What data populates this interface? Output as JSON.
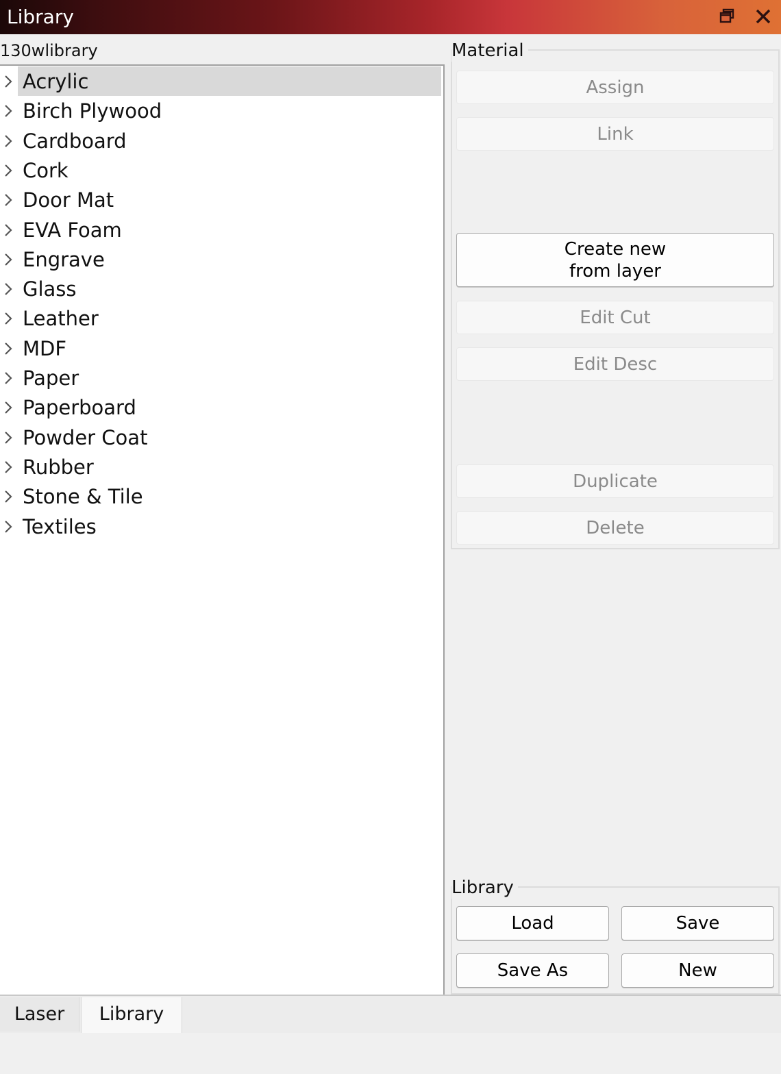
{
  "window": {
    "title": "Library"
  },
  "library_name": "130wlibrary",
  "tree": {
    "selected_index": 0,
    "items": [
      {
        "label": "Acrylic"
      },
      {
        "label": "Birch Plywood"
      },
      {
        "label": "Cardboard"
      },
      {
        "label": "Cork"
      },
      {
        "label": "Door Mat"
      },
      {
        "label": "EVA Foam"
      },
      {
        "label": "Engrave"
      },
      {
        "label": "Glass"
      },
      {
        "label": "Leather"
      },
      {
        "label": "MDF"
      },
      {
        "label": "Paper"
      },
      {
        "label": "Paperboard"
      },
      {
        "label": "Powder Coat"
      },
      {
        "label": "Rubber"
      },
      {
        "label": "Stone & Tile"
      },
      {
        "label": "Textiles"
      }
    ]
  },
  "material": {
    "title": "Material",
    "assign_label": "Assign",
    "link_label": "Link",
    "create_line1": "Create new",
    "create_line2": "from layer",
    "edit_cut_label": "Edit Cut",
    "edit_desc_label": "Edit Desc",
    "duplicate_label": "Duplicate",
    "delete_label": "Delete"
  },
  "library_group": {
    "title": "Library",
    "load_label": "Load",
    "save_label": "Save",
    "save_as_label": "Save As",
    "new_label": "New"
  },
  "tabs": [
    {
      "label": "Laser",
      "active": false
    },
    {
      "label": "Library",
      "active": true
    }
  ],
  "colors": {
    "selection": "#d9d9d9",
    "disabled_text": "#8a8a8a",
    "titlebar_start": "#1b0808",
    "titlebar_end": "#df7134"
  },
  "icons": {
    "restore": "restore-window-icon",
    "close": "close-icon",
    "expand": "chevron-right-icon"
  }
}
